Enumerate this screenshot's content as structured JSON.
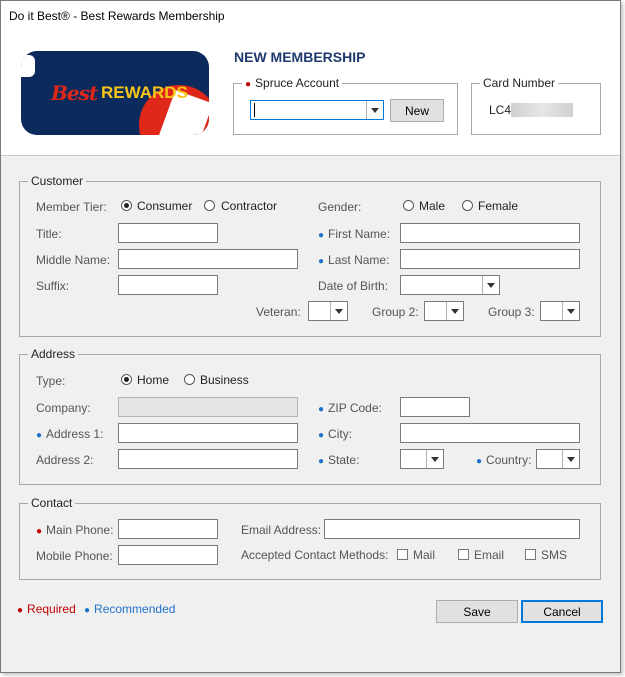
{
  "window": {
    "title": "Do it Best® - Best Rewards Membership"
  },
  "header": {
    "logo": {
      "text_best": "Best",
      "text_rewards": "REWARDS"
    },
    "title": "NEW MEMBERSHIP",
    "spruce_account": {
      "label": "Spruce Account",
      "value": "",
      "new_button": "New"
    },
    "card_number": {
      "label": "Card Number",
      "value": "LC4"
    }
  },
  "customer": {
    "group_label": "Customer",
    "member_tier": {
      "label": "Member Tier:",
      "options": [
        "Consumer",
        "Contractor"
      ],
      "selected": "Consumer"
    },
    "gender": {
      "label": "Gender:",
      "options": [
        "Male",
        "Female"
      ],
      "selected": ""
    },
    "title_label": "Title:",
    "first_name_label": "First Name:",
    "middle_name_label": "Middle Name:",
    "last_name_label": "Last Name:",
    "suffix_label": "Suffix:",
    "dob_label": "Date of Birth:",
    "veteran_label": "Veteran:",
    "group2_label": "Group 2:",
    "group3_label": "Group 3:"
  },
  "address": {
    "group_label": "Address",
    "type": {
      "label": "Type:",
      "options": [
        "Home",
        "Business"
      ],
      "selected": "Home"
    },
    "company_label": "Company:",
    "zip_label": "ZIP Code:",
    "address1_label": "Address 1:",
    "city_label": "City:",
    "address2_label": "Address 2:",
    "state_label": "State:",
    "country_label": "Country:"
  },
  "contact": {
    "group_label": "Contact",
    "main_phone_label": "Main Phone:",
    "email_label": "Email Address:",
    "mobile_phone_label": "Mobile Phone:",
    "methods_label": "Accepted Contact Methods:",
    "methods": [
      "Mail",
      "Email",
      "SMS"
    ]
  },
  "legend": {
    "required": "Required",
    "recommended": "Recommended"
  },
  "buttons": {
    "save": "Save",
    "cancel": "Cancel"
  },
  "colors": {
    "required": "#c00000",
    "recommended": "#1e73c8",
    "title": "#1e3a6e",
    "focus": "#0078d7"
  }
}
